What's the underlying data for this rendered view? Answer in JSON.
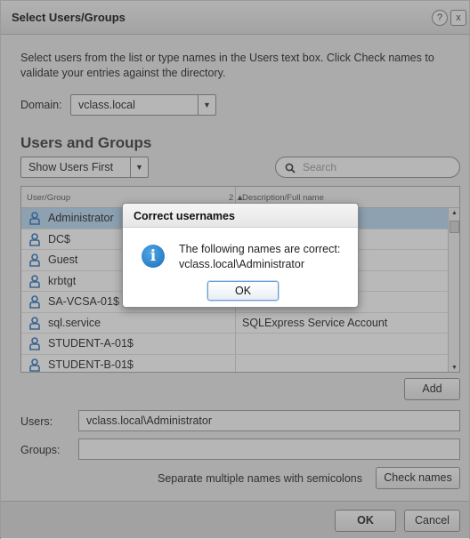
{
  "window": {
    "title": "Select Users/Groups",
    "help_glyph": "?",
    "close_glyph": "x"
  },
  "instructions": "Select users from the list or type names in the Users text box. Click Check names to validate your entries against the directory.",
  "domain": {
    "label": "Domain:",
    "value": "vclass.local"
  },
  "section_title": "Users and Groups",
  "filter": {
    "value": "Show Users First"
  },
  "search": {
    "placeholder": "Search"
  },
  "table": {
    "headers": {
      "user_group": "User/Group",
      "sort": "2 ▲",
      "description": "Description/Full name"
    },
    "rows": [
      {
        "name": "Administrator",
        "description": "",
        "selected": true
      },
      {
        "name": "DC$",
        "description": ""
      },
      {
        "name": "Guest",
        "description": ""
      },
      {
        "name": "krbtgt",
        "description": ""
      },
      {
        "name": "SA-VCSA-01$",
        "description": ""
      },
      {
        "name": "sql.service",
        "description": "SQLExpress Service Account"
      },
      {
        "name": "STUDENT-A-01$",
        "description": ""
      },
      {
        "name": "STUDENT-B-01$",
        "description": ""
      }
    ]
  },
  "add_button": "Add",
  "users": {
    "label": "Users:",
    "value": "vclass.local\\Administrator"
  },
  "groups": {
    "label": "Groups:",
    "value": ""
  },
  "hint": "Separate multiple names with semicolons",
  "check_names_button": "Check names",
  "footer": {
    "ok": "OK",
    "cancel": "Cancel"
  },
  "modal": {
    "title": "Correct usernames",
    "line1": "The following names are correct:",
    "line2": "vclass.local\\Administrator",
    "ok": "OK"
  },
  "colors": {
    "selected_row": "#b9d8f3",
    "user_icon": "#2f76c2",
    "info_icon": "#1c6fb8"
  }
}
